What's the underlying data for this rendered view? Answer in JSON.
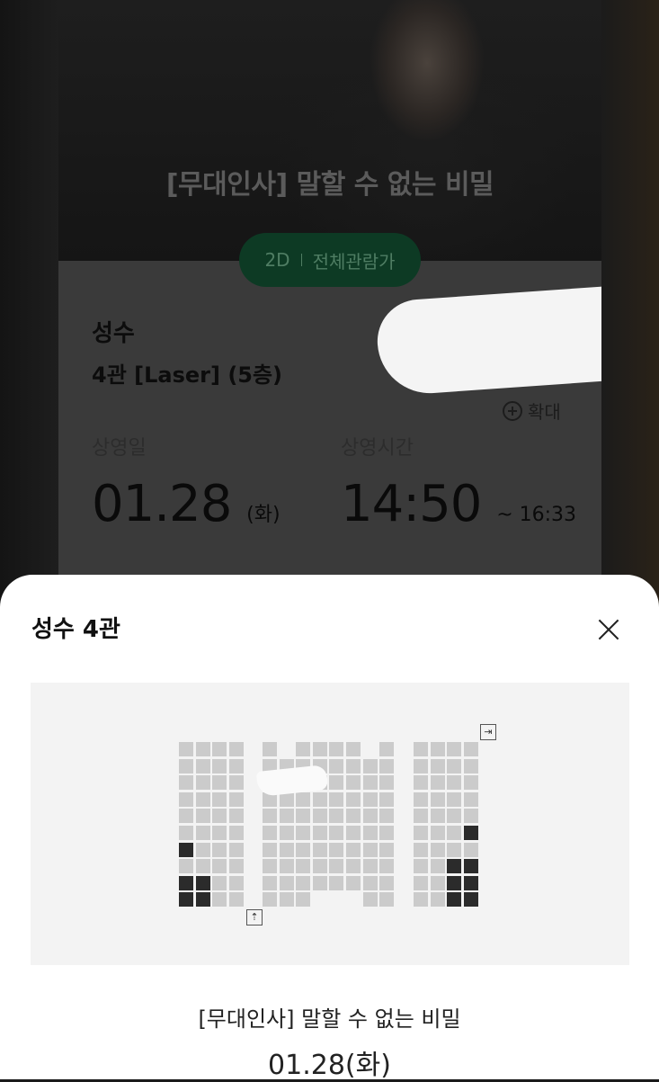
{
  "movie": {
    "title": "[무대인사] 말할 수 없는 비밀",
    "format": "2D",
    "rating": "전체관람가"
  },
  "theater": {
    "name": "성수",
    "hall": "4관 [Laser] (5층)",
    "zoom_label": "확대"
  },
  "schedule": {
    "date_label": "상영일",
    "date": "01.28",
    "weekday": "(화)",
    "time_label": "상영시간",
    "start": "14:50",
    "end": "~ 16:33"
  },
  "sheet": {
    "title": "성수 4관",
    "footer_title": "[무대인사] 말할 수 없는 비밀",
    "footer_date": "01.28(화)"
  },
  "seatmap": {
    "blocks": [
      {
        "cols": 4,
        "rows": 10,
        "missing": [],
        "taken": [
          [
            6,
            0
          ],
          [
            8,
            0
          ],
          [
            8,
            1
          ],
          [
            9,
            0
          ],
          [
            9,
            1
          ]
        ]
      },
      {
        "cols": 8,
        "rows": 10,
        "missing": [
          [
            0,
            1
          ],
          [
            0,
            6
          ],
          [
            9,
            3
          ],
          [
            9,
            4
          ],
          [
            9,
            5
          ]
        ],
        "taken": []
      },
      {
        "cols": 4,
        "rows": 10,
        "missing": [],
        "taken": [
          [
            5,
            3
          ],
          [
            7,
            2
          ],
          [
            7,
            3
          ],
          [
            8,
            2
          ],
          [
            8,
            3
          ],
          [
            9,
            2
          ],
          [
            9,
            3
          ]
        ]
      }
    ],
    "colors": {
      "available": "#cbcbcb",
      "taken": "#2b2b2b"
    }
  }
}
